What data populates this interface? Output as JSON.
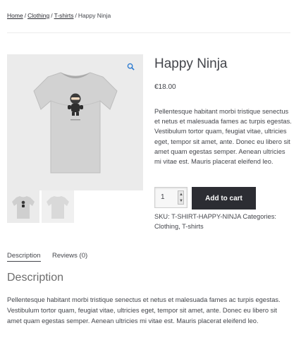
{
  "breadcrumb": {
    "items": [
      "Home",
      "Clothing",
      "T-shirts"
    ],
    "separator": "/",
    "current": "Happy Ninja"
  },
  "product": {
    "title": "Happy Ninja",
    "price": "€18.00",
    "short_description": "Pellentesque habitant morbi tristique senectus et netus et malesuada fames ac turpis egestas. Vestibulum tortor quam, feugiat vitae, ultricies eget, tempor sit amet, ante. Donec eu libero sit amet quam egestas semper. Aenean ultricies mi vitae est. Mauris placerat eleifend leo.",
    "quantity": "1",
    "add_to_cart_label": "Add to cart",
    "sku_label": "SKU:",
    "sku": "T-SHIRT-HAPPY-NINJA",
    "categories_label": "Categories:",
    "categories": [
      "Clothing",
      "T-shirts"
    ],
    "category_separator": ", "
  },
  "tabs": [
    {
      "label": "Description",
      "active": true
    },
    {
      "label": "Reviews (0)",
      "active": false
    }
  ],
  "description": {
    "heading": "Description",
    "body": "Pellentesque habitant morbi tristique senectus et netus et malesuada fames ac turpis egestas. Vestibulum tortor quam, feugiat vitae, ultricies eget, tempor sit amet, ante. Donec eu libero sit amet quam egestas semper. Aenean ultricies mi vitae est. Mauris placerat eleifend leo."
  },
  "icons": {
    "zoom": "search-icon"
  },
  "colors": {
    "button_bg": "#2c2d33",
    "button_text": "#ffffff",
    "text": "#43454b",
    "image_bg": "#ebebeb",
    "shirt": "#d2d2d2"
  }
}
